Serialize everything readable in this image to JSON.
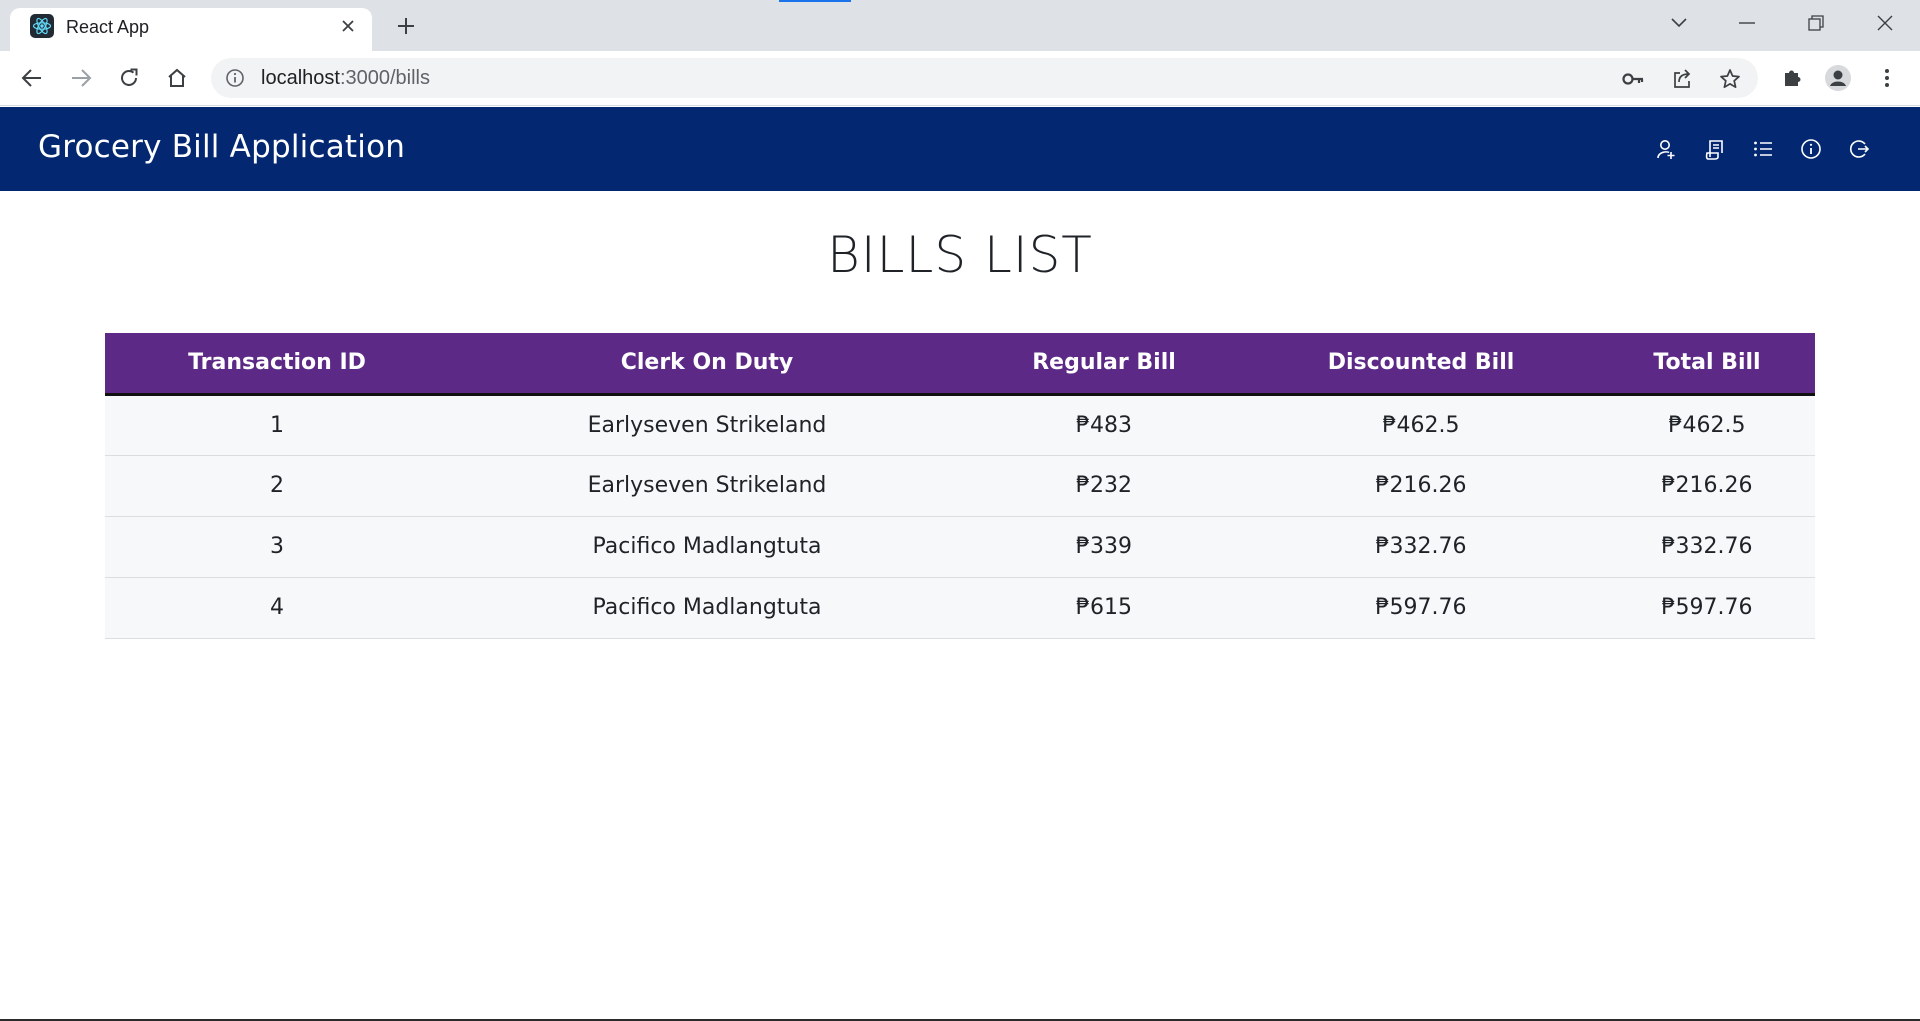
{
  "browser": {
    "tab_title": "React App",
    "url_host": "localhost",
    "url_path": ":3000/bills"
  },
  "app": {
    "brand": "Grocery Bill Application",
    "nav_icons": [
      "user-add-icon",
      "receipt-icon",
      "list-icon",
      "info-icon",
      "logout-icon"
    ]
  },
  "page": {
    "title": "BILLS LIST"
  },
  "table": {
    "headers": [
      "Transaction ID",
      "Clerk On Duty",
      "Regular Bill",
      "Discounted Bill",
      "Total Bill"
    ],
    "rows": [
      [
        "1",
        "Earlyseven Strikeland",
        "₱483",
        "₱462.5",
        "₱462.5"
      ],
      [
        "2",
        "Earlyseven Strikeland",
        "₱232",
        "₱216.26",
        "₱216.26"
      ],
      [
        "3",
        "Pacifico Madlangtuta",
        "₱339",
        "₱332.76",
        "₱332.76"
      ],
      [
        "4",
        "Pacifico Madlangtuta",
        "₱615",
        "₱597.76",
        "₱597.76"
      ]
    ]
  },
  "colors": {
    "navbar": "#032871",
    "table_header": "#5c2a86"
  }
}
